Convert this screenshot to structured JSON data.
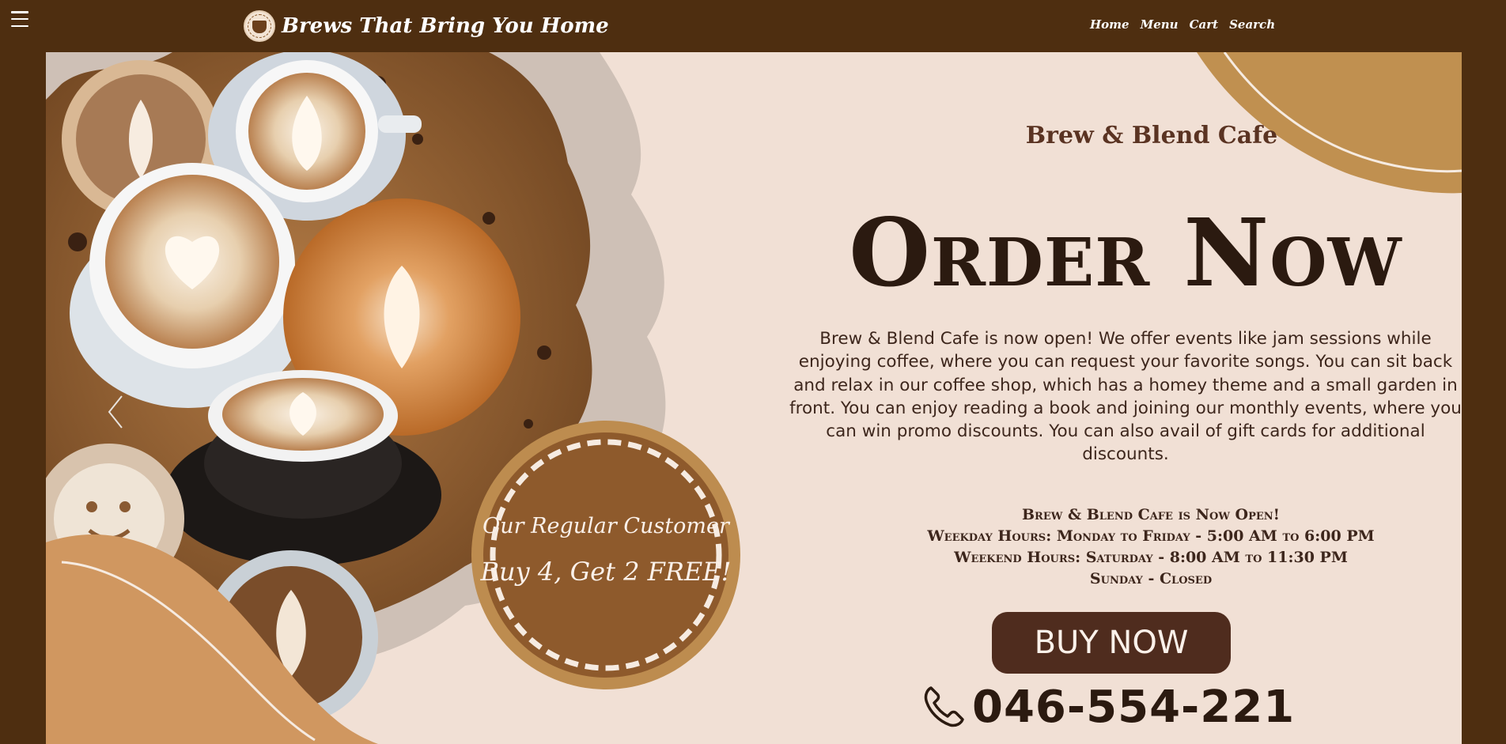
{
  "header": {
    "menu_icon": "hamburger-icon",
    "brand": "Brews That Bring You Home",
    "logo": "cafe-logo",
    "nav": [
      "Home",
      "Menu",
      "Cart",
      "Search"
    ]
  },
  "hero": {
    "shop_name": "Brew & Blend Cafe",
    "headline": "Order Now",
    "description": "Brew & Blend Cafe is now open! We offer events like jam sessions while enjoying coffee, where you can request your favorite songs. You can sit back and relax in our coffee shop, which has a homey theme and a small garden in front. You can enjoy reading a book and joining our monthly events, where you can win promo discounts. You can also avail of gift cards for additional discounts.",
    "hours": [
      "Brew & Blend Cafe is Now Open!",
      "Weekday Hours: Monday to Friday - 5:00 AM to 6:00 PM",
      "Weekend Hours: Saturday - 8:00 AM to 11:30 PM",
      "Sunday - Closed"
    ],
    "cta": "BUY NOW",
    "phone": "046-554-221",
    "promo": {
      "line1": "Our Regular Customer",
      "line2": "Buy 4, Get 2 FREE!"
    },
    "carousel_prev_icon": "chevron-left-icon",
    "phone_icon": "phone-icon"
  },
  "colors": {
    "background": "#4e2e10",
    "banner": "#f1e0d5",
    "accent": "#c09050",
    "button": "#4f2c1e",
    "promo_circle": "#8e5a2c"
  }
}
